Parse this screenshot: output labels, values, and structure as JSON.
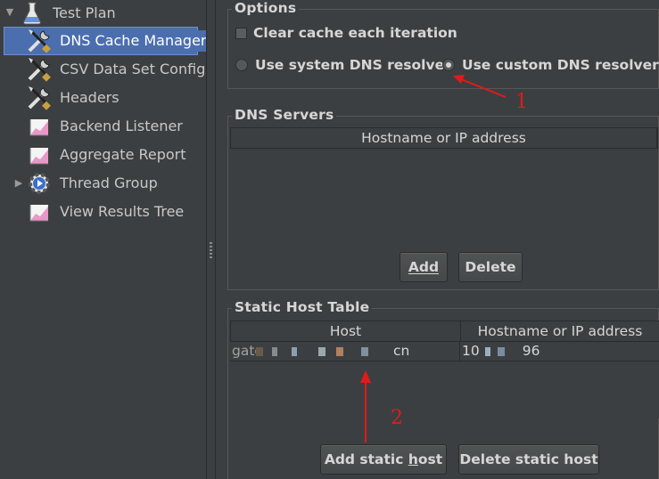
{
  "tree": {
    "items": [
      {
        "label": "Test Plan",
        "icon": "flask-icon"
      },
      {
        "label": "DNS Cache Manager",
        "icon": "tools-icon",
        "selected": true
      },
      {
        "label": "CSV Data Set Config",
        "icon": "tools-icon"
      },
      {
        "label": "Headers",
        "icon": "tools-icon"
      },
      {
        "label": "Backend Listener",
        "icon": "graph-icon"
      },
      {
        "label": "Aggregate Report",
        "icon": "graph-icon"
      },
      {
        "label": "Thread Group",
        "icon": "gear-icon"
      },
      {
        "label": "View Results Tree",
        "icon": "graph-icon"
      }
    ]
  },
  "options": {
    "title": "Options",
    "clear_cache_label": "Clear cache each iteration",
    "system_resolver_label": "Use system DNS resolver",
    "custom_resolver_label": "Use custom DNS resolver",
    "selected_resolver": "custom"
  },
  "dns_servers": {
    "title": "DNS Servers",
    "column": "Hostname or IP address",
    "add_label": "Add",
    "delete_label": "Delete"
  },
  "static_hosts": {
    "title": "Static Host Table",
    "columns": [
      "Host",
      "Hostname or IP address"
    ],
    "rows": [
      {
        "host_prefix": "gate",
        "host_suffix": "cn",
        "ip_prefix": "10",
        "ip_suffix": "96"
      }
    ],
    "add_label": "Add static host",
    "delete_label": "Delete static host"
  },
  "annotations": {
    "one": "1",
    "two": "2"
  },
  "colors": {
    "background": "#3c3f41",
    "selection": "#4b6eaf",
    "annotation": "#e31a1a"
  }
}
